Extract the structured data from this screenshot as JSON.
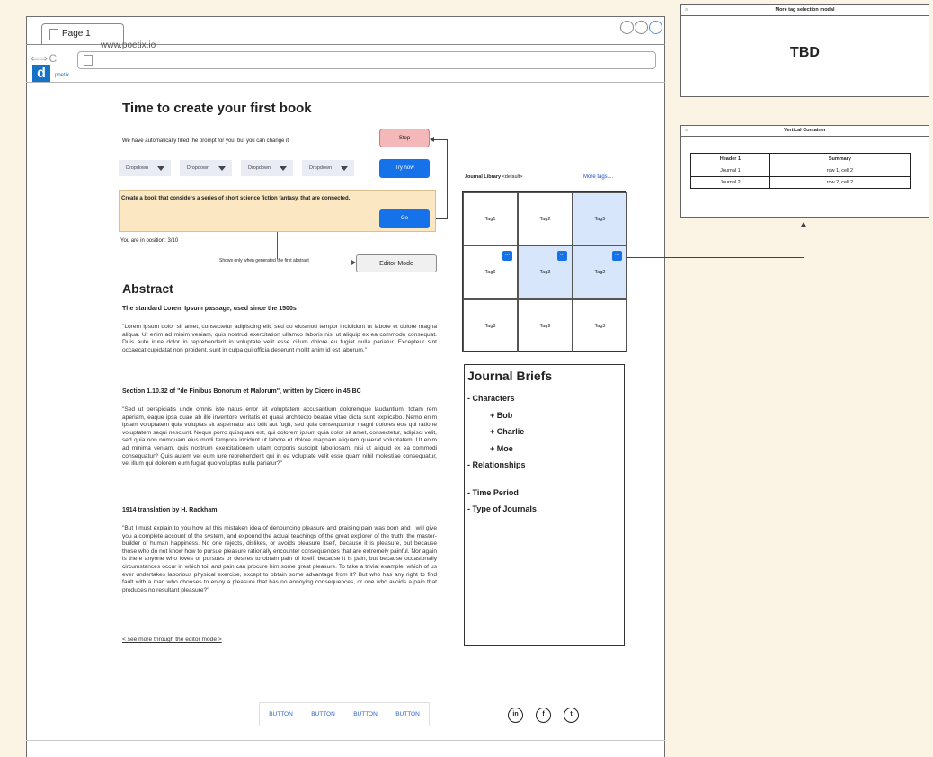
{
  "browser": {
    "tab_title": "Page 1",
    "url": "www.poetix.io",
    "nav_glyph": "⇐⇒ C",
    "logo_letter": "d",
    "logo_text": "poetix"
  },
  "main": {
    "title": "Time to create your first book",
    "autofill_text": "We have automatically filled the prompt for you! but you can change it",
    "stop_label": "Stop",
    "dropdowns": [
      "Dropdown",
      "Dropdown",
      "Dropdown",
      "Dropdown"
    ],
    "try_label": "Try now",
    "prompt": "Create a book that considers a series of short science fiction fantasy, that are connected.",
    "go_label": "Go",
    "position_text": "You are in position:  3/10",
    "shows_note": "Shows only when generated the first abstract",
    "editor_label": "Editor Mode"
  },
  "abstract": {
    "heading": "Abstract",
    "sub1": "The standard Lorem Ipsum passage, used since the 1500s",
    "para1": "\"Lorem ipsum dolor sit amet, consectetur adipiscing elit, sed do eiusmod tempor incididunt ut labore et dolore magna aliqua. Ut enim ad minim veniam, quis nostrud exercitation ullamco laboris nisi ut aliquip ex ea commodo consequat. Duis aute irure dolor in reprehenderit in voluptate velit esse cillum dolore eu fugiat nulla pariatur. Excepteur sint occaecat cupidatat non proident, sunt in culpa qui officia deserunt mollit anim id est laborum.\"",
    "sub2": "Section 1.10.32 of \"de Finibus Bonorum et Malorum\", written by Cicero in 45 BC",
    "para2": "\"Sed ut perspiciatis unde omnis iste natus error sit voluptatem accusantium doloremque laudantium, totam rem aperiam, eaque ipsa quae ab illo inventore veritatis et quasi architecto beatae vitae dicta sunt explicabo. Nemo enim ipsam voluptatem quia voluptas sit aspernatur aut odit aut fugit, sed quia consequuntur magni dolores eos qui ratione voluptatem sequi nesciunt. Neque porro quisquam est, qui dolorem ipsum quia dolor sit amet, consectetur, adipisci velit, sed quia non numquam eius modi tempora incidunt ut labore et dolore magnam aliquam quaerat voluptatem. Ut enim ad minima veniam, quis nostrum exercitationem ullam corporis suscipit laboriosam, nisi ut aliquid ex ea commodi consequatur? Quis autem vel eum iure reprehenderit qui in ea voluptate velit esse quam nihil molestiae consequatur, vel illum qui dolorem eum fugiat quo voluptas nulla pariatur?\"",
    "sub3": "1914 translation by H. Rackham",
    "para3": "\"But I must explain to you how all this mistaken idea of denouncing pleasure and praising pain was born and I will give you a complete account of the system, and expound the actual teachings of the great explorer of the truth, the master-builder of human happiness. No one rejects, dislikes, or avoids pleasure itself, because it is pleasure, but because those who do not know how to pursue pleasure rationally encounter consequences that are extremely painful. Nor again is there anyone who loves or pursues or desires to obtain pain of itself, because it is pain, but because occasionally circumstances occur in which toil and pain can procure him some great pleasure. To take a trivial example, which of us ever undertakes laborious physical exercise, except to obtain some advantage from it? But who has any right to find fault with a man who chooses to enjoy a pleasure that has no annoying consequences, or one who avoids a pain that produces no resultant pleasure?\"",
    "more_link": "< see more through the editor mode >"
  },
  "library": {
    "title": "Journal Library",
    "title_suffix": "<default>",
    "more_tags": "More tags....",
    "tags": [
      "Tag1",
      "Tag2",
      "Tag5",
      "Tag6",
      "Tag3",
      "Tag2",
      "Tag8",
      "Tag9",
      "Tag3"
    ],
    "mini_label": "..."
  },
  "briefs": {
    "title": "Journal Briefs",
    "characters": "- Characters",
    "bob": "+ Bob",
    "charlie": "+ Charlie",
    "moe": "+ Moe",
    "relationships": "- Relationships",
    "time_period": "- Time Period",
    "type_journals": "- Type of Journals"
  },
  "footer": {
    "buttons": [
      "BUTTON",
      "BUTTON",
      "BUTTON",
      "BUTTON"
    ],
    "social": [
      "in",
      "f",
      "t"
    ]
  },
  "modal": {
    "title": "More tag selection modal",
    "body": "TBD"
  },
  "container": {
    "title": "Vertical Container",
    "headers": [
      "Header 1",
      "Summary"
    ],
    "rows": [
      [
        "Journal 1",
        "row 1, cell 2"
      ],
      [
        "Journal 2",
        "row 2, cell 2"
      ]
    ]
  },
  "colors": {
    "accent": "#1572e8",
    "stop": "#f4b8b8",
    "prompt_bg": "#fbe8c2",
    "selected_tag": "#d7e6fb",
    "page_bg": "#fbf3e4"
  },
  "icons": [
    "page-icon",
    "back-icon",
    "forward-icon",
    "reload-icon",
    "linkedin-icon",
    "facebook-icon",
    "twitter-icon",
    "panel-menu-icon"
  ]
}
